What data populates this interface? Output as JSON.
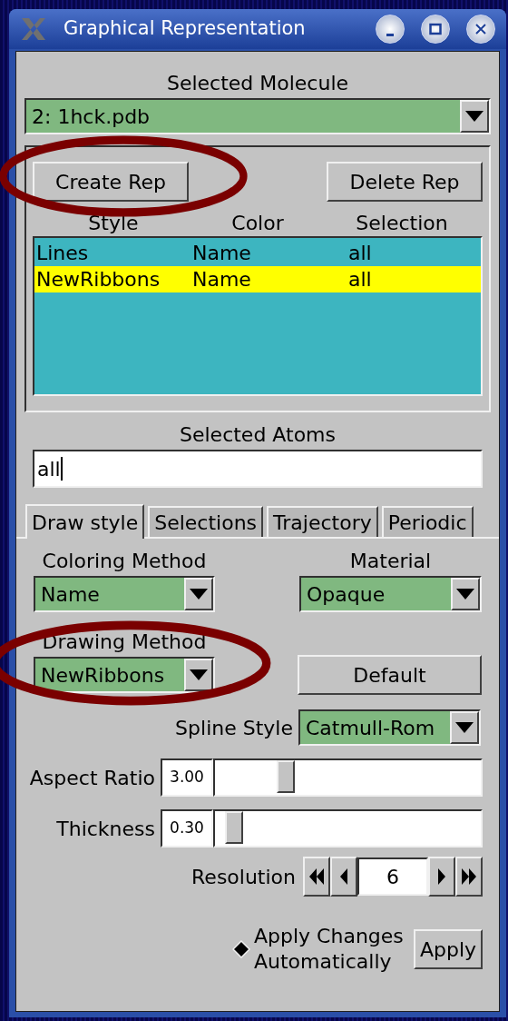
{
  "window": {
    "title": "Graphical Representation"
  },
  "molecule": {
    "label": "Selected Molecule",
    "value": "2: 1hck.pdb"
  },
  "rep_buttons": [
    "Create Rep",
    "Delete Rep"
  ],
  "reps": {
    "columns": [
      "Style",
      "Color",
      "Selection"
    ],
    "rows": [
      {
        "cells": [
          "Lines",
          "Name",
          "all"
        ],
        "selected": false
      },
      {
        "cells": [
          "NewRibbons",
          "Name",
          "all"
        ],
        "selected": true
      }
    ]
  },
  "atoms": {
    "label": "Selected Atoms",
    "value": "all"
  },
  "tabs": [
    {
      "label": "Draw style",
      "selected": true
    },
    {
      "label": "Selections",
      "selected": false
    },
    {
      "label": "Trajectory",
      "selected": false
    },
    {
      "label": "Periodic",
      "selected": false
    }
  ],
  "coloring": {
    "label": "Coloring Method",
    "value": "Name"
  },
  "material": {
    "label": "Material",
    "value": "Opaque"
  },
  "drawing": {
    "label": "Drawing Method",
    "value": "NewRibbons"
  },
  "default_button": "Default",
  "spline": {
    "label": "Spline Style",
    "value": "Catmull-Rom"
  },
  "sliders": [
    {
      "label": "Aspect Ratio",
      "value": "3.00",
      "level": 0.25
    },
    {
      "label": "Thickness",
      "value": "0.30",
      "level": 0.04
    }
  ],
  "resolution": {
    "label": "Resolution",
    "value": "6"
  },
  "auto_apply": {
    "label": "Apply Changes Automatically",
    "checked": true
  },
  "apply_button": "Apply"
}
